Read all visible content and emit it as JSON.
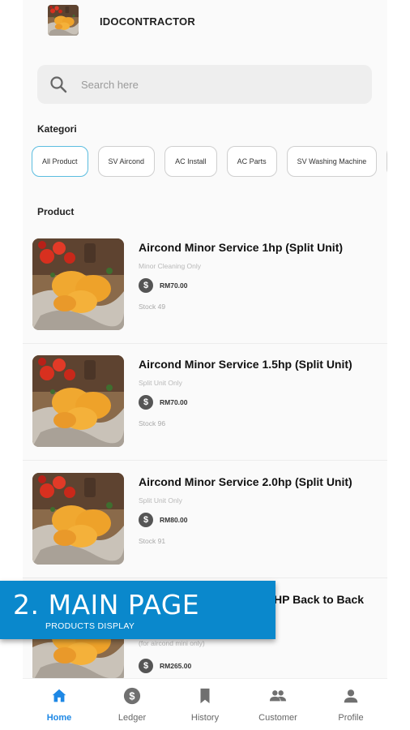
{
  "app": {
    "title": "IDOCONTRACTOR"
  },
  "search": {
    "placeholder": "Search here"
  },
  "categories": {
    "heading": "Kategori",
    "items": [
      "All Product",
      "SV Aircond",
      "AC Install",
      "AC Parts",
      "SV Washing Machine"
    ],
    "active_index": 0
  },
  "products": {
    "heading": "Product",
    "items": [
      {
        "name": "Aircond Minor Service 1hp (Split Unit)",
        "description": "Minor Cleaning Only",
        "price": "RM70.00",
        "stock": "Stock 49"
      },
      {
        "name": "Aircond Minor Service 1.5hp (Split Unit)",
        "description": "Split Unit Only",
        "price": "RM70.00",
        "stock": "Stock 96"
      },
      {
        "name": "Aircond Minor Service 2.0hp (Split Unit)",
        "description": "Split Unit Only",
        "price": "RM80.00",
        "stock": "Stock 91"
      },
      {
        "name": "HP Back to Back",
        "description": "(for aircond mini only)",
        "price": "RM265.00",
        "stock": ""
      }
    ]
  },
  "banner": {
    "title": "2. MAIN PAGE",
    "subtitle": "PRODUCTS DISPLAY"
  },
  "nav": {
    "items": [
      {
        "label": "Home",
        "icon": "home-icon"
      },
      {
        "label": "Ledger",
        "icon": "dollar-icon"
      },
      {
        "label": "History",
        "icon": "bookmark-icon"
      },
      {
        "label": "Customer",
        "icon": "people-icon"
      },
      {
        "label": "Profile",
        "icon": "person-icon"
      }
    ],
    "active_index": 0
  },
  "colors": {
    "accent": "#1e88e5",
    "banner": "#0a88cc",
    "chip_active_border": "#5bbde0"
  }
}
